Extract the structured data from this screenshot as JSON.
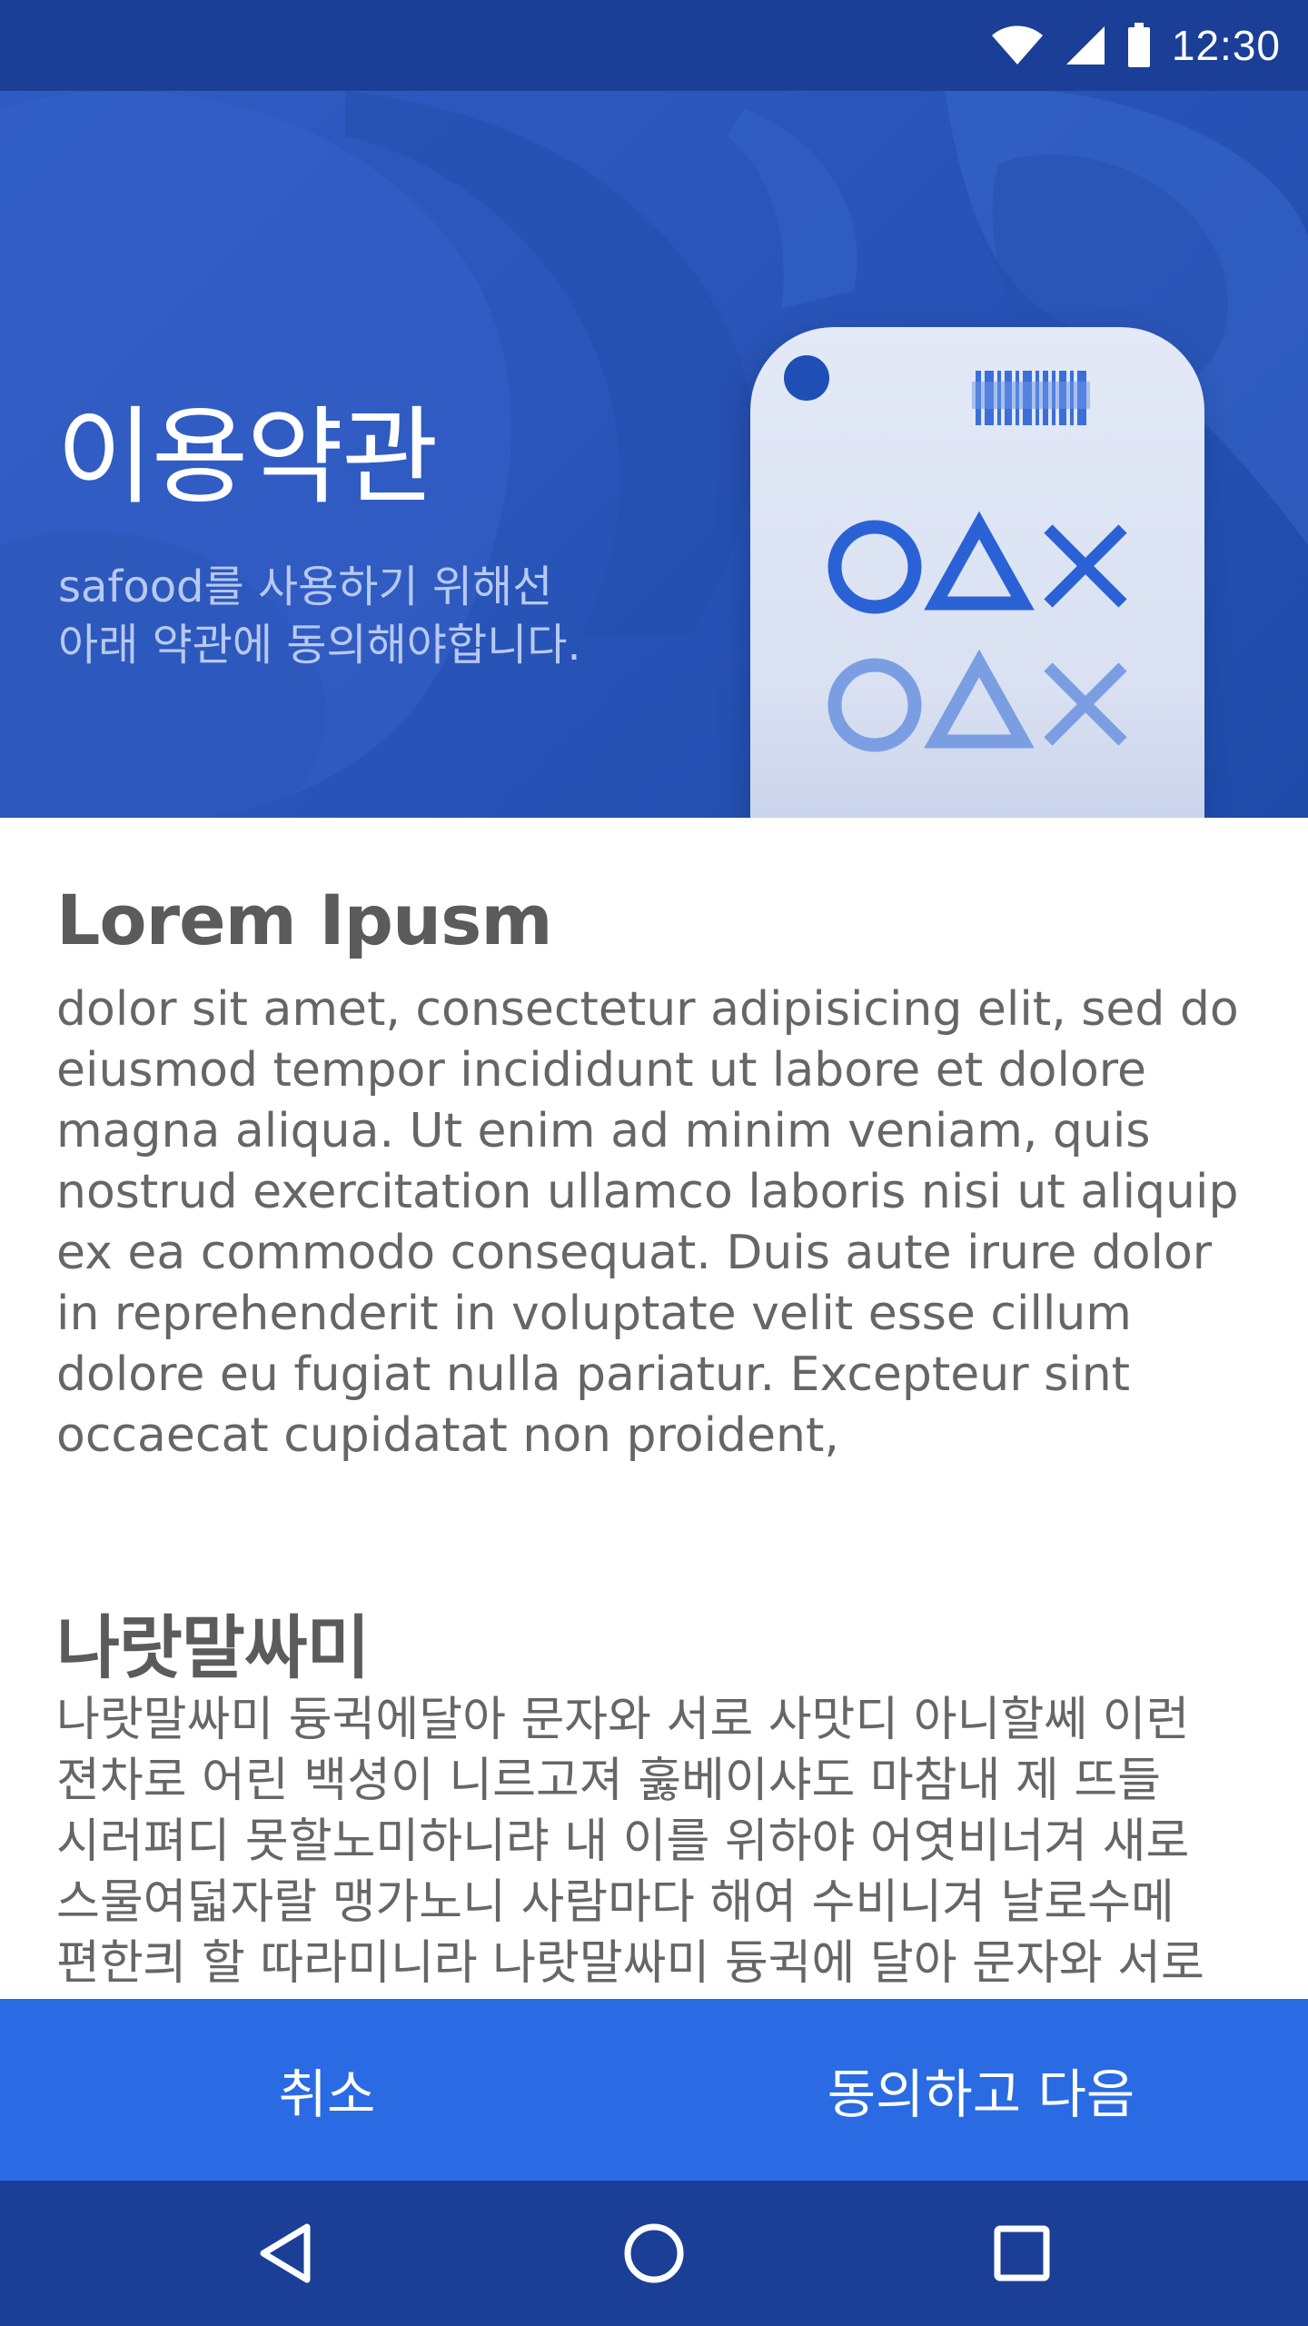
{
  "status_bar": {
    "time": "12:30",
    "icons": [
      "wifi-icon",
      "signal-icon",
      "battery-icon"
    ]
  },
  "hero": {
    "title": "이용약관",
    "subtitle_lines": [
      "safood를 사용하기 위해선",
      "아래 약관에 동의해야합니다."
    ],
    "illustration": {
      "symbols": [
        "circle",
        "triangle",
        "cross"
      ],
      "colors": {
        "card": "#dde4f3",
        "primary_symbol": "#2a62d6",
        "faded_symbol": "#7b9ee3"
      }
    }
  },
  "sections": [
    {
      "heading": "Lorem Ipusm",
      "lines": [
        "dolor sit amet, consectetur adipisicing elit, sed do",
        "eiusmod tempor incididunt ut labore et dolore",
        "magna aliqua. Ut enim ad minim veniam, quis",
        "nostrud exercitation ullamco laboris nisi ut aliquip",
        "ex ea commodo consequat. Duis aute irure dolor",
        "in reprehenderit in voluptate velit esse cillum",
        "dolore eu fugiat nulla pariatur. Excepteur sint",
        "occaecat cupidatat non proident,"
      ]
    },
    {
      "heading": "나랏말싸미",
      "lines": [
        "나랏말싸미 듕귁에달아 문자와 서로 사맛디 아니할쎄 이런",
        "젼차로 어린 백셩이 니르고져 훓베이샤도 마참내 제 뜨들",
        "시러펴디 못할노미하니랴 내 이를 위하야 어엿비너겨 새로",
        "스물여덟자랄 맹가노니 사람마다 해여 수비니겨 날로수메",
        "편한킈 할 따라미니라 나랏말싸미 듕귁에 달아 문자와 서로"
      ]
    }
  ],
  "actions": {
    "cancel_label": "취소",
    "agree_label": "동의하고 다음"
  },
  "navigation": {
    "icons": [
      "back-icon",
      "home-icon",
      "recents-icon"
    ]
  },
  "colors": {
    "hero_blue": "#2b56bb",
    "status_bar": "#1b3f96",
    "action_bar": "#2a6be3",
    "nav_bar": "#1b3f96",
    "heading_text": "#5b5b5b",
    "body_text": "#666666"
  }
}
